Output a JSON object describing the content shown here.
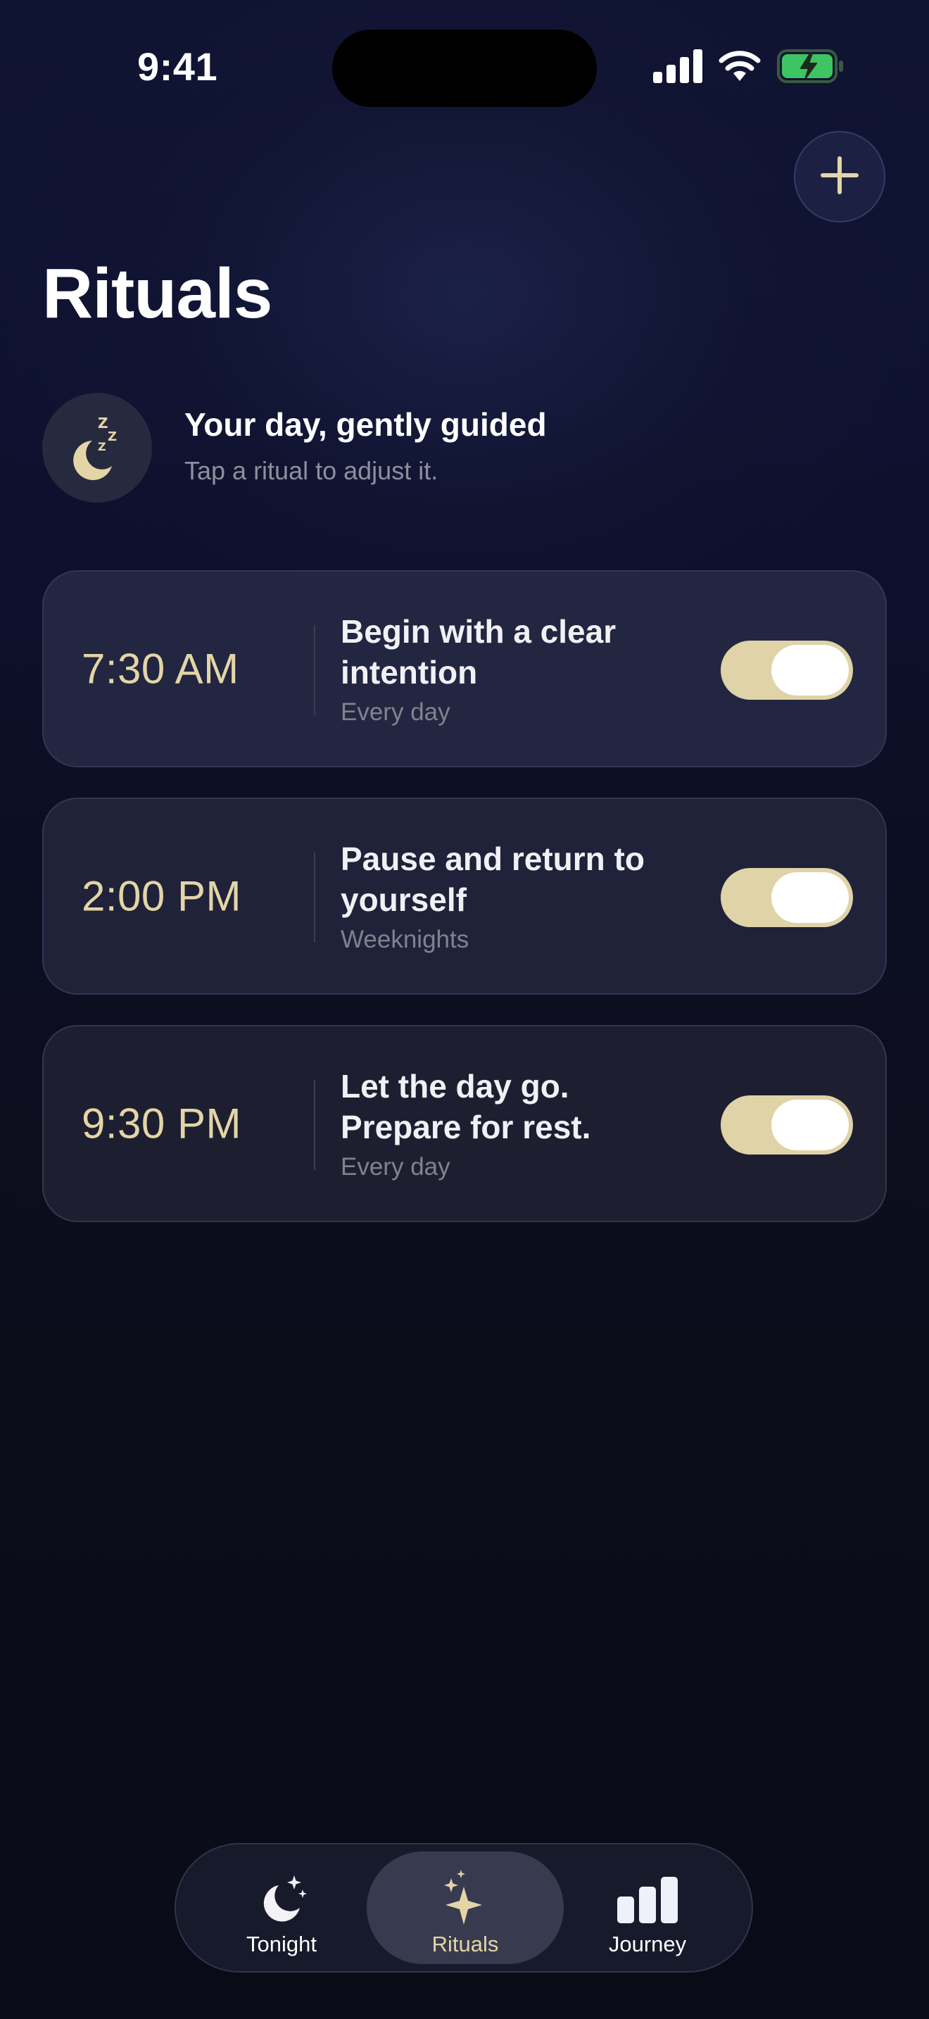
{
  "status_bar": {
    "time": "9:41"
  },
  "header": {
    "title": "Rituals",
    "add_button_icon": "plus-icon"
  },
  "intro": {
    "icon": "moon-sleep-icon",
    "title": "Your day, gently guided",
    "subtitle": "Tap a ritual to adjust it."
  },
  "rituals": [
    {
      "time": "7:30 AM",
      "title": "Begin with a clear intention",
      "repeat": "Every day",
      "enabled": true
    },
    {
      "time": "2:00 PM",
      "title": "Pause and return to yourself",
      "repeat": "Weeknights",
      "enabled": true
    },
    {
      "time": "9:30 PM",
      "title": "Let the day go. Prepare for rest.",
      "repeat": "Every day",
      "enabled": true
    }
  ],
  "tabbar": {
    "tabs": [
      {
        "label": "Tonight",
        "icon": "moon-stars-icon",
        "active": false
      },
      {
        "label": "Rituals",
        "icon": "sparkles-icon",
        "active": true
      },
      {
        "label": "Journey",
        "icon": "bars-icon",
        "active": false
      }
    ]
  },
  "colors": {
    "accent": "#e4d5a6",
    "background": "#0b0d1a",
    "battery": "#3ec463"
  }
}
